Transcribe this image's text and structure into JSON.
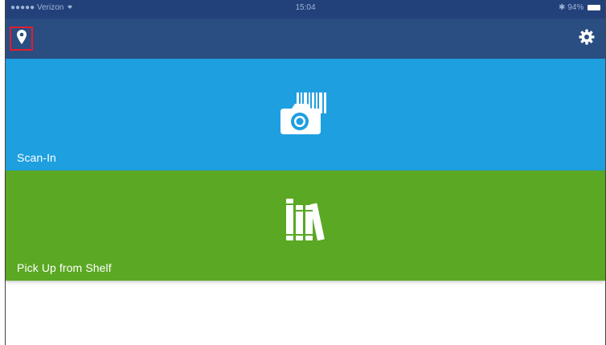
{
  "status_bar": {
    "signal": "●●●●● Verizon",
    "wifi_icon": "wifi-icon",
    "time": "15:04",
    "bluetooth_icon": "bluetooth-icon",
    "battery": "94%"
  },
  "nav": {
    "location_icon": "location-pin-icon",
    "settings_icon": "gear-icon"
  },
  "tiles": [
    {
      "label": "Scan-In",
      "icon": "camera-barcode-icon",
      "color": "#1e9fe0"
    },
    {
      "label": "Pick Up from Shelf",
      "icon": "books-icon",
      "color": "#5aa823"
    }
  ],
  "colors": {
    "status_bar": "#22417a",
    "nav_bar": "#2a4d82",
    "highlight": "#e01f2d"
  }
}
